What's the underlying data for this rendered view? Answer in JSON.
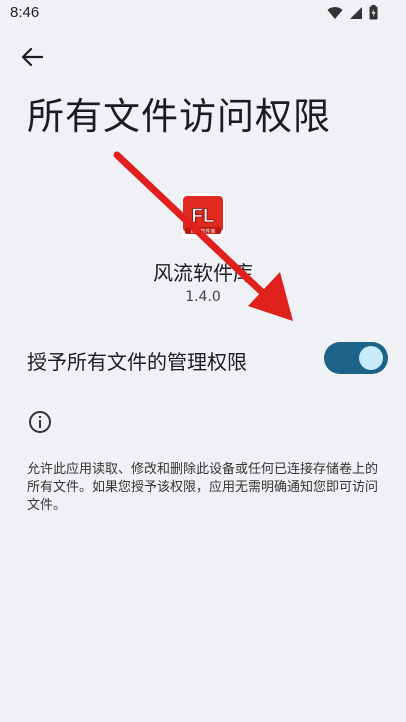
{
  "status_bar": {
    "time": "8:46",
    "icons": [
      "wifi-icon",
      "signal-icon",
      "battery-icon"
    ]
  },
  "header": {
    "back_icon": "arrow-back-icon",
    "title": "所有文件访问权限"
  },
  "app": {
    "icon_text": "FL",
    "icon_caption": "风流软件库",
    "name": "风流软件库",
    "version": "1.4.0"
  },
  "permission": {
    "label": "授予所有文件的管理权限",
    "enabled": true
  },
  "info": {
    "icon": "info-icon",
    "description": "允许此应用读取、修改和删除此设备或任何已连接存储卷上的所有文件。如果您授予该权限，应用无需明确通知您即可访问文件。"
  },
  "colors": {
    "background": "#f0f1f4",
    "toggle_track": "#1d6288",
    "toggle_knob": "#c8ebfa",
    "annotation_arrow": "#e0201c",
    "app_icon_red": "#e02a20"
  }
}
